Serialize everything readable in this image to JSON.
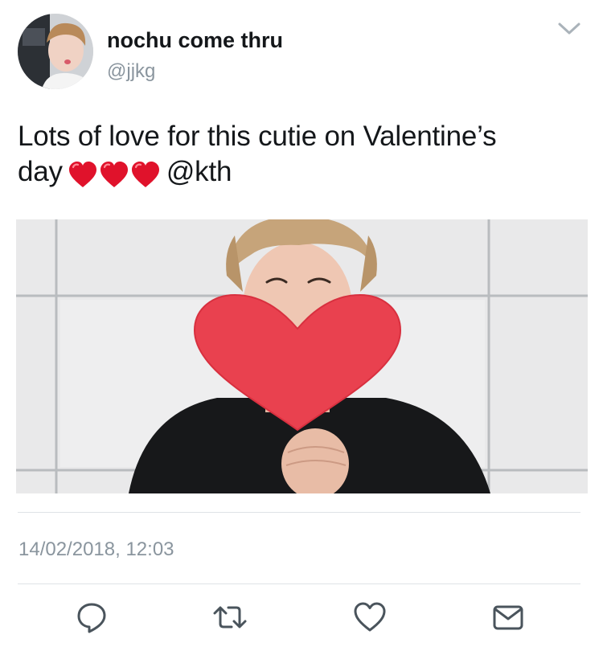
{
  "tweet": {
    "display_name": "nochu come thru",
    "handle": "@jjkg",
    "text_line1": "Lots of love for this cutie on Valentine’s",
    "text_line2_word": "day",
    "text_mention": "@kth",
    "hearts_count": 3,
    "timestamp": "14/02/2018, 12:03"
  },
  "icons": {
    "menu": "chevron-down-icon",
    "reply": "reply-icon",
    "retweet": "retweet-icon",
    "like": "heart-icon",
    "share": "envelope-icon",
    "emoji": "red-heart-emoji"
  },
  "colors": {
    "text": "#14171a",
    "secondary": "#8a959e",
    "divider": "#dfe3e6",
    "emoji_heart": "#e0122b"
  }
}
